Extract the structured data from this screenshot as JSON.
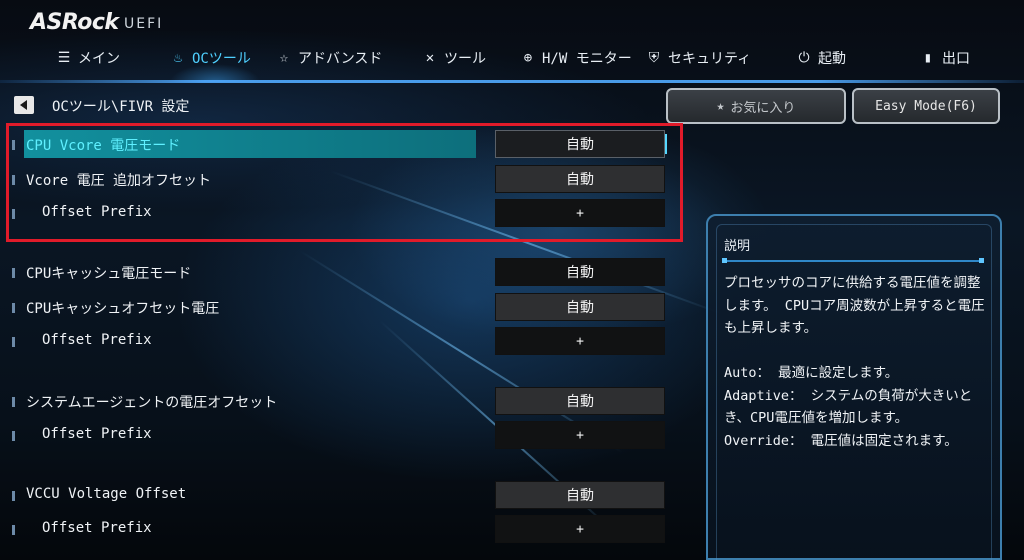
{
  "brand": {
    "logo": "ASRock",
    "suffix": "UEFI"
  },
  "nav": {
    "tabs": [
      {
        "label": "メイン",
        "icon": "list-icon"
      },
      {
        "label": "OCツール",
        "icon": "flame-icon",
        "active": true
      },
      {
        "label": "アドバンスド",
        "icon": "star-icon"
      },
      {
        "label": "ツール",
        "icon": "tools-icon"
      },
      {
        "label": "H/W モニター",
        "icon": "target-icon"
      },
      {
        "label": "セキュリティ",
        "icon": "shield-icon"
      },
      {
        "label": "起動",
        "icon": "power-icon"
      },
      {
        "label": "出口",
        "icon": "exit-door-icon"
      }
    ]
  },
  "breadcrumb": "OCツール\\FIVR 設定",
  "buttons": {
    "favorites": "お気に入り",
    "easy_mode": "Easy Mode(F6)"
  },
  "settings": [
    {
      "label": "CPU Vcore 電圧モード",
      "value": "自動"
    },
    {
      "label": "Vcore 電圧 追加オフセット",
      "value": "自動"
    },
    {
      "label": "Offset Prefix",
      "value": "+"
    },
    {
      "label": "CPUキャッシュ電圧モード",
      "value": "自動"
    },
    {
      "label": "CPUキャッシュオフセット電圧",
      "value": "自動"
    },
    {
      "label": "Offset Prefix",
      "value": "+"
    },
    {
      "label": "システムエージェントの電圧オフセット",
      "value": "自動"
    },
    {
      "label": "Offset Prefix",
      "value": "+"
    },
    {
      "label": "VCCU Voltage Offset",
      "value": "自動"
    },
    {
      "label": "Offset Prefix",
      "value": "+"
    }
  ],
  "description": {
    "title": "説明",
    "text": "プロセッサのコアに供給する電圧値を調整します。 CPUコア周波数が上昇すると電圧も上昇します。\n\nAuto： 最適に設定します。\nAdaptive： システムの負荷が大きいとき、CPU電圧値を増加します。\nOverride： 電圧値は固定されます。"
  },
  "colors": {
    "accent": "#4fd0ff",
    "highlight": "#12909e",
    "annotation_box": "#e11b2a"
  }
}
